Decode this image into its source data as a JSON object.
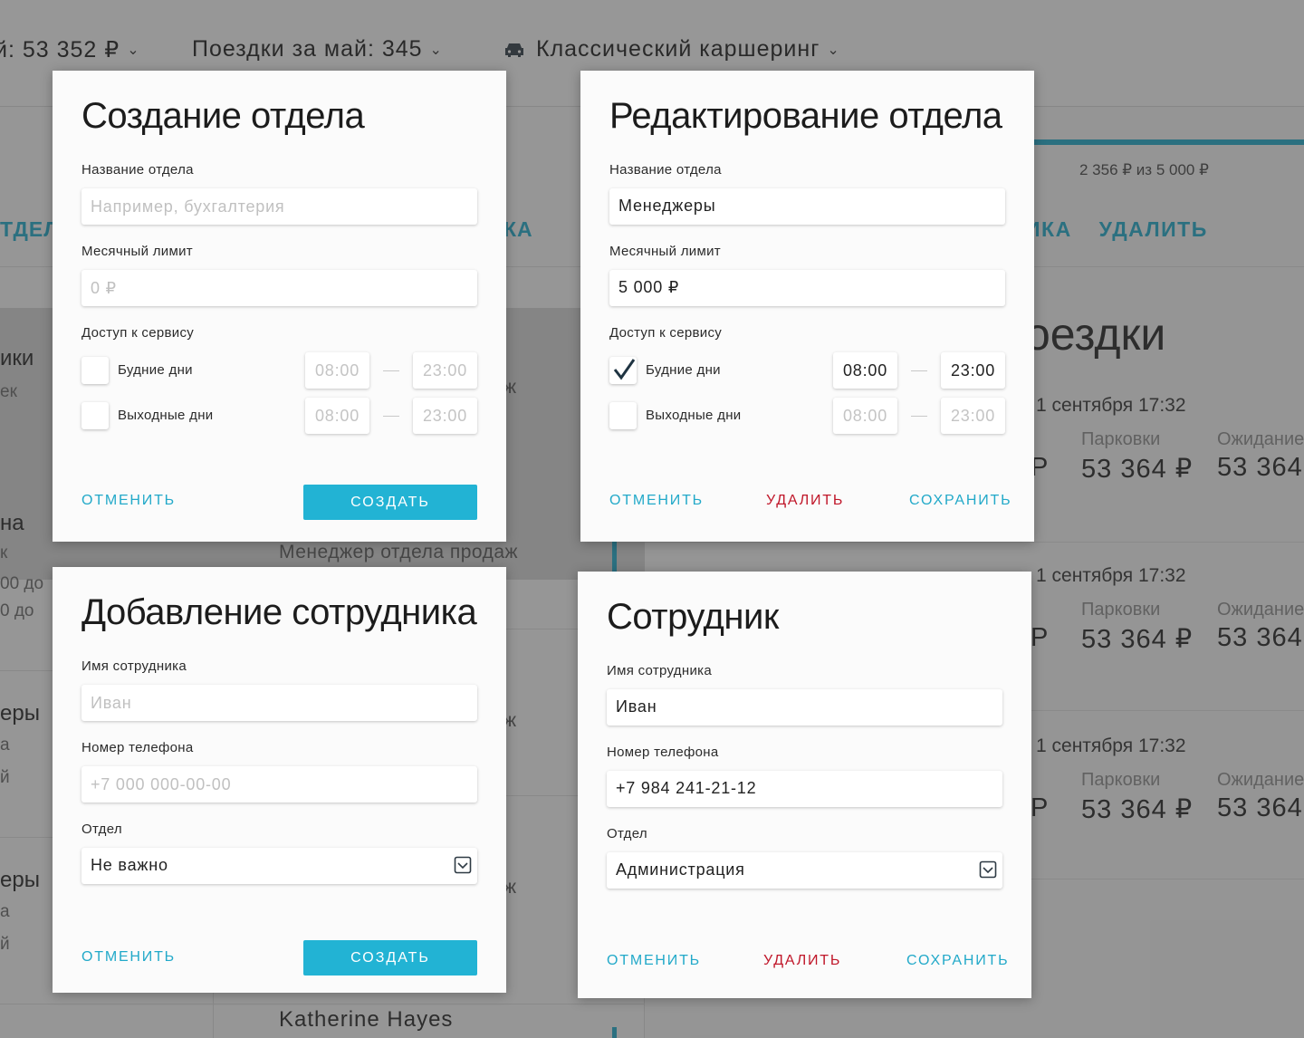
{
  "background": {
    "header": {
      "monthly_spend": "й: 53 352 ₽",
      "trips": "Поездки за май: 345",
      "service": "Классический каршеринг"
    },
    "sidebar": {
      "tab": "ТДЕЛ",
      "items": [
        {
          "label": "ики",
          "sub": "ек"
        },
        {
          "label": "на",
          "sub": "к",
          "sub2": "00 до",
          "sub3": "0 до"
        },
        {
          "label": "еры",
          "sub": "а",
          "sub2": "й"
        },
        {
          "label": "еры",
          "sub": "а",
          "sub2": "й"
        }
      ]
    },
    "middle": {
      "tab": "КА",
      "role_text": "ж",
      "employee_role": "Менеджер отдела продаж",
      "employee_name": "Katherine Hayes"
    },
    "right": {
      "limit_text": "2 356 ₽ из 5 000 ₽",
      "tab_history": "ИКА",
      "tab_delete": "УДАЛИТЬ",
      "title": "оездки",
      "trips": [
        {
          "date": "1 сентября 17:32",
          "k1": "Парковки",
          "k2": "Ожидание",
          "v1": "53 364 ₽",
          "v2": "53 364",
          "p": "Р"
        },
        {
          "date": "1 сентября 17:32",
          "k1": "Парковки",
          "k2": "Ожидание",
          "v1": "53 364 ₽",
          "v2": "53 364",
          "p": "Р"
        },
        {
          "date": "1 сентября 17:32",
          "k1": "Парковки",
          "k2": "Ожидание",
          "v1": "53 364 ₽",
          "v2": "53 364",
          "p": "Р"
        }
      ]
    }
  },
  "create_department": {
    "title": "Создание отдела",
    "name_label": "Название отдела",
    "name_placeholder": "Например, бухгалтерия",
    "limit_label": "Месячный лимит",
    "limit_placeholder": "0 ₽",
    "access_label": "Доступ к сервису",
    "weekdays_label": "Будние дни",
    "weekends_label": "Выходные дни",
    "weekdays_checked": false,
    "weekends_checked": false,
    "weekdays_from": "08:00",
    "weekdays_to": "23:00",
    "weekends_from": "08:00",
    "weekends_to": "23:00",
    "cancel": "ОТМЕНИТЬ",
    "submit": "СОЗДАТЬ"
  },
  "edit_department": {
    "title": "Редактирование отдела",
    "name_label": "Название отдела",
    "name_value": "Менеджеры",
    "limit_label": "Месячный лимит",
    "limit_value": "5 000 ₽",
    "access_label": "Доступ к сервису",
    "weekdays_label": "Будние дни",
    "weekends_label": "Выходные дни",
    "weekdays_checked": true,
    "weekends_checked": false,
    "weekdays_from": "08:00",
    "weekdays_to": "23:00",
    "weekends_from": "08:00",
    "weekends_to": "23:00",
    "cancel": "ОТМЕНИТЬ",
    "delete": "УДАЛИТЬ",
    "save": "СОХРАНИТЬ"
  },
  "add_employee": {
    "title": "Добавление сотрудника",
    "name_label": "Имя сотрудника",
    "name_placeholder": "Иван",
    "phone_label": "Номер телефона",
    "phone_placeholder": "+7 000 000-00-00",
    "department_label": "Отдел",
    "department_value": "Не важно",
    "cancel": "ОТМЕНИТЬ",
    "submit": "СОЗДАТЬ"
  },
  "employee": {
    "title": "Сотрудник",
    "name_label": "Имя сотрудника",
    "name_value": "Иван",
    "phone_label": "Номер телефона",
    "phone_value": "+7 984 241-21-12",
    "department_label": "Отдел",
    "department_value": "Администрация",
    "cancel": "ОТМЕНИТЬ",
    "delete": "УДАЛИТЬ",
    "save": "СОХРАНИТЬ"
  },
  "colors": {
    "accent": "#22b3d4",
    "accent_text": "#22a9c9",
    "danger": "#c0172a",
    "dialog_bg": "#fbfbfb"
  }
}
